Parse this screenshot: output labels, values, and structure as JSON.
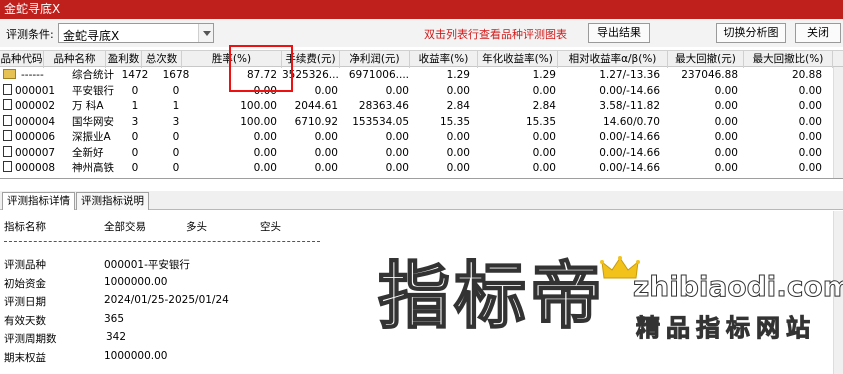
{
  "window": {
    "title": "金蛇寻底X"
  },
  "toolbar": {
    "condition_label": "评测条件:",
    "condition_value": "金蛇寻底X",
    "hint": "双击列表行查看品种评测图表",
    "export_label": "导出结果",
    "switch_label": "切换分析图",
    "close_label": "关闭"
  },
  "table": {
    "headers": [
      "品种代码",
      "品种名称",
      "盈利数",
      "总次数",
      "胜率(%)",
      "手续费(元)",
      "净利润(元)",
      "收益率(%)",
      "年化收益率(%)",
      "相对收益率α/β(%)",
      "最大回撤(元)",
      "最大回撤比(%)"
    ],
    "rows": [
      [
        "------",
        "综合统计",
        "1472",
        "1678",
        "87.72",
        "3525326....",
        "6971006....",
        "1.29",
        "1.29",
        "1.27/-13.36",
        "237046.88",
        "20.88"
      ],
      [
        "000001",
        "平安银行",
        "0",
        "0",
        "0.00",
        "0.00",
        "0.00",
        "0.00",
        "0.00",
        "0.00/-14.66",
        "0.00",
        "0.00"
      ],
      [
        "000002",
        "万 科A",
        "1",
        "1",
        "100.00",
        "2044.61",
        "28363.46",
        "2.84",
        "2.84",
        "3.58/-11.82",
        "0.00",
        "0.00"
      ],
      [
        "000004",
        "国华网安",
        "3",
        "3",
        "100.00",
        "6710.92",
        "153534.05",
        "15.35",
        "15.35",
        "14.60/0.70",
        "0.00",
        "0.00"
      ],
      [
        "000006",
        "深振业A",
        "0",
        "0",
        "0.00",
        "0.00",
        "0.00",
        "0.00",
        "0.00",
        "0.00/-14.66",
        "0.00",
        "0.00"
      ],
      [
        "000007",
        "全新好",
        "0",
        "0",
        "0.00",
        "0.00",
        "0.00",
        "0.00",
        "0.00",
        "0.00/-14.66",
        "0.00",
        "0.00"
      ],
      [
        "000008",
        "神州高铁",
        "0",
        "0",
        "0.00",
        "0.00",
        "0.00",
        "0.00",
        "0.00",
        "0.00/-14.66",
        "0.00",
        "0.00"
      ]
    ]
  },
  "tabs": [
    "评测指标详情",
    "评测指标说明"
  ],
  "detail": {
    "col_headers": [
      "指标名称",
      "全部交易",
      "多头",
      "空头"
    ],
    "rows": [
      {
        "label": "评测品种",
        "value": "000001-平安银行"
      },
      {
        "label": "初始资金",
        "value": "1000000.00"
      },
      {
        "label": "评测日期",
        "value": "2024/01/25-2025/01/24"
      },
      {
        "label": "有效天数",
        "value": "365"
      },
      {
        "label": "评测周期数",
        "value": "342"
      },
      {
        "label": "期末权益",
        "value": "1000000.00"
      }
    ]
  },
  "watermark": {
    "big": "指标帝",
    "url": "zhibiaodi.com",
    "slogan": "精品指标网站"
  },
  "colors": {
    "titlebar": "#c0201c",
    "hint": "#d21a1a",
    "highlight_box": "#e11111"
  }
}
